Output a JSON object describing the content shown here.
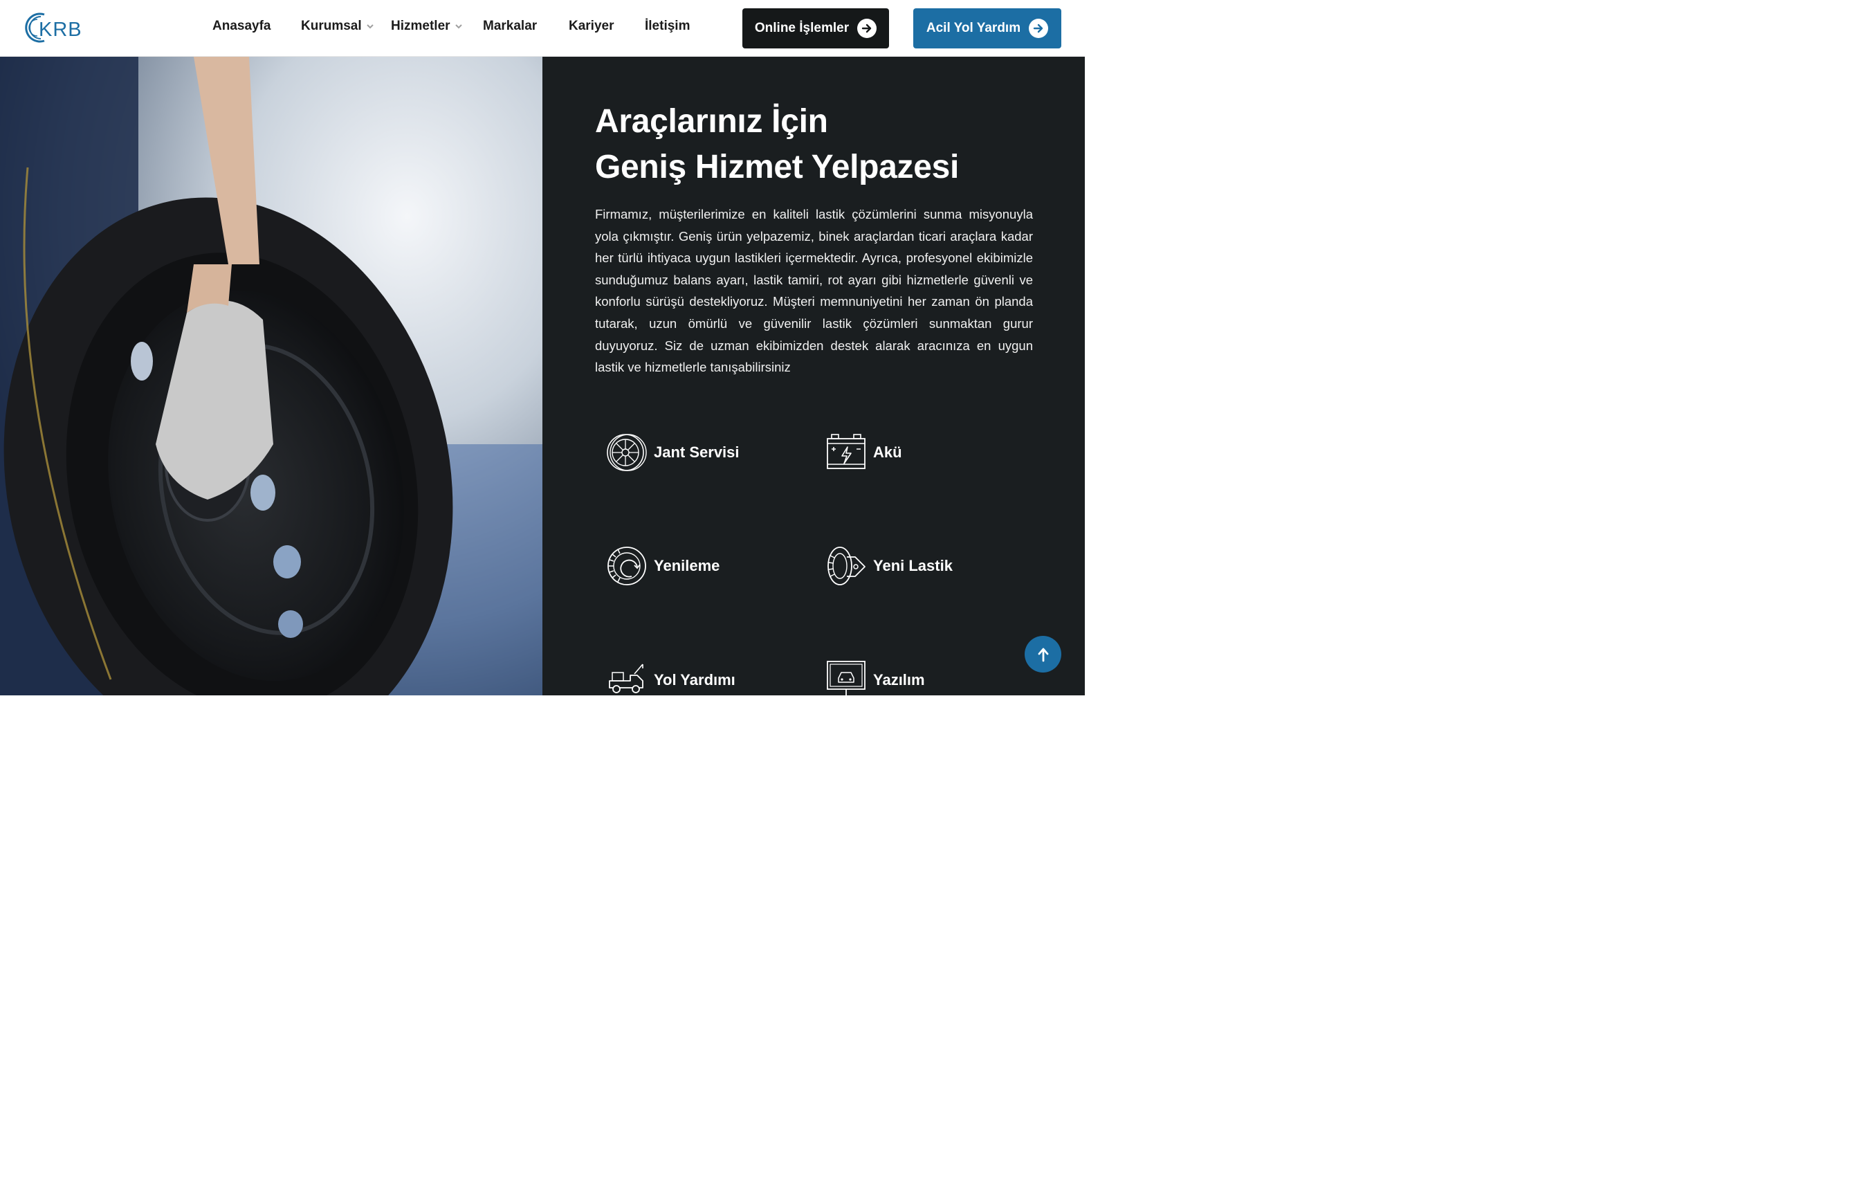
{
  "brand": {
    "logo_text": "KRB",
    "accent": "#1c6ea4",
    "dark": "#151819"
  },
  "nav": {
    "items": [
      {
        "label": "Anasayfa",
        "dropdown": false
      },
      {
        "label": "Kurumsal",
        "dropdown": true
      },
      {
        "label": "Hizmetler",
        "dropdown": true
      },
      {
        "label": "Markalar",
        "dropdown": false
      },
      {
        "label": "Kariyer",
        "dropdown": false
      },
      {
        "label": "İletişim",
        "dropdown": false
      }
    ],
    "online_button": "Online İşlemler",
    "emergency_button": "Acil Yol Yardım"
  },
  "hero": {
    "title_line1": "Araçlarınız İçin",
    "title_line2": "Geniş Hizmet Yelpazesi",
    "description": "Firmamız, müşterilerimize en kaliteli lastik çözümlerini sunma misyonuyla yola çıkmıştır. Geniş ürün yelpazemiz, binek araçlardan ticari araçlara kadar her türlü ihtiyaca uygun lastikleri içermektedir. Ayrıca, profesyonel ekibimizle sunduğumuz balans ayarı, lastik tamiri, rot ayarı gibi hizmetlerle güvenli ve konforlu sürüşü destekliyoruz. Müşteri memnuniyetini her zaman ön planda tutarak, uzun ömürlü ve güvenilir lastik çözümleri sunmaktan gurur duyuyoruz. Siz de uzman ekibimizden destek alarak aracınıza en uygun lastik ve hizmetlerle tanışabilirsiniz"
  },
  "services": [
    {
      "label": "Jant Servisi",
      "icon": "rim-icon"
    },
    {
      "label": "Akü",
      "icon": "battery-icon"
    },
    {
      "label": "Yenileme",
      "icon": "tire-retread-icon"
    },
    {
      "label": "Yeni Lastik",
      "icon": "new-tire-icon"
    },
    {
      "label": "Yol Yardımı",
      "icon": "tow-truck-icon"
    },
    {
      "label": "Yazılım",
      "icon": "diagnostic-screen-icon"
    }
  ],
  "scroll_top": {
    "icon": "arrow-up-icon"
  }
}
